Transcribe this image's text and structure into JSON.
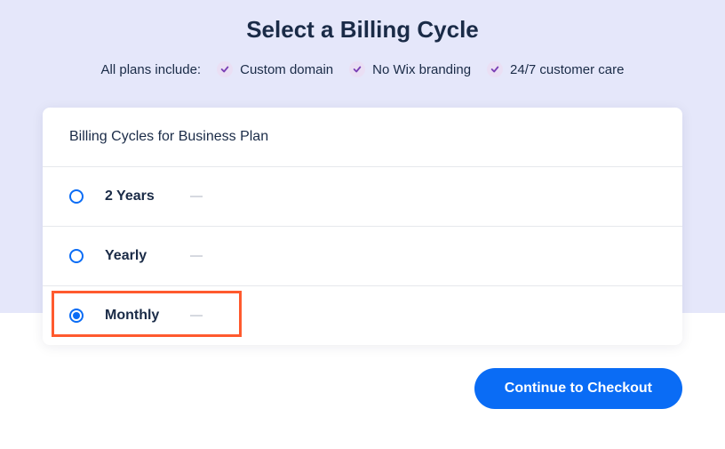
{
  "header": {
    "title": "Select a Billing Cycle",
    "features_intro": "All plans include:",
    "features": [
      {
        "label": "Custom domain"
      },
      {
        "label": "No Wix branding"
      },
      {
        "label": "24/7 customer care"
      }
    ]
  },
  "card": {
    "title": "Billing Cycles for Business Plan",
    "options": [
      {
        "label": "2 Years",
        "selected": false
      },
      {
        "label": "Yearly",
        "selected": false
      },
      {
        "label": "Monthly",
        "selected": true
      }
    ]
  },
  "cta": {
    "label": "Continue to Checkout"
  }
}
